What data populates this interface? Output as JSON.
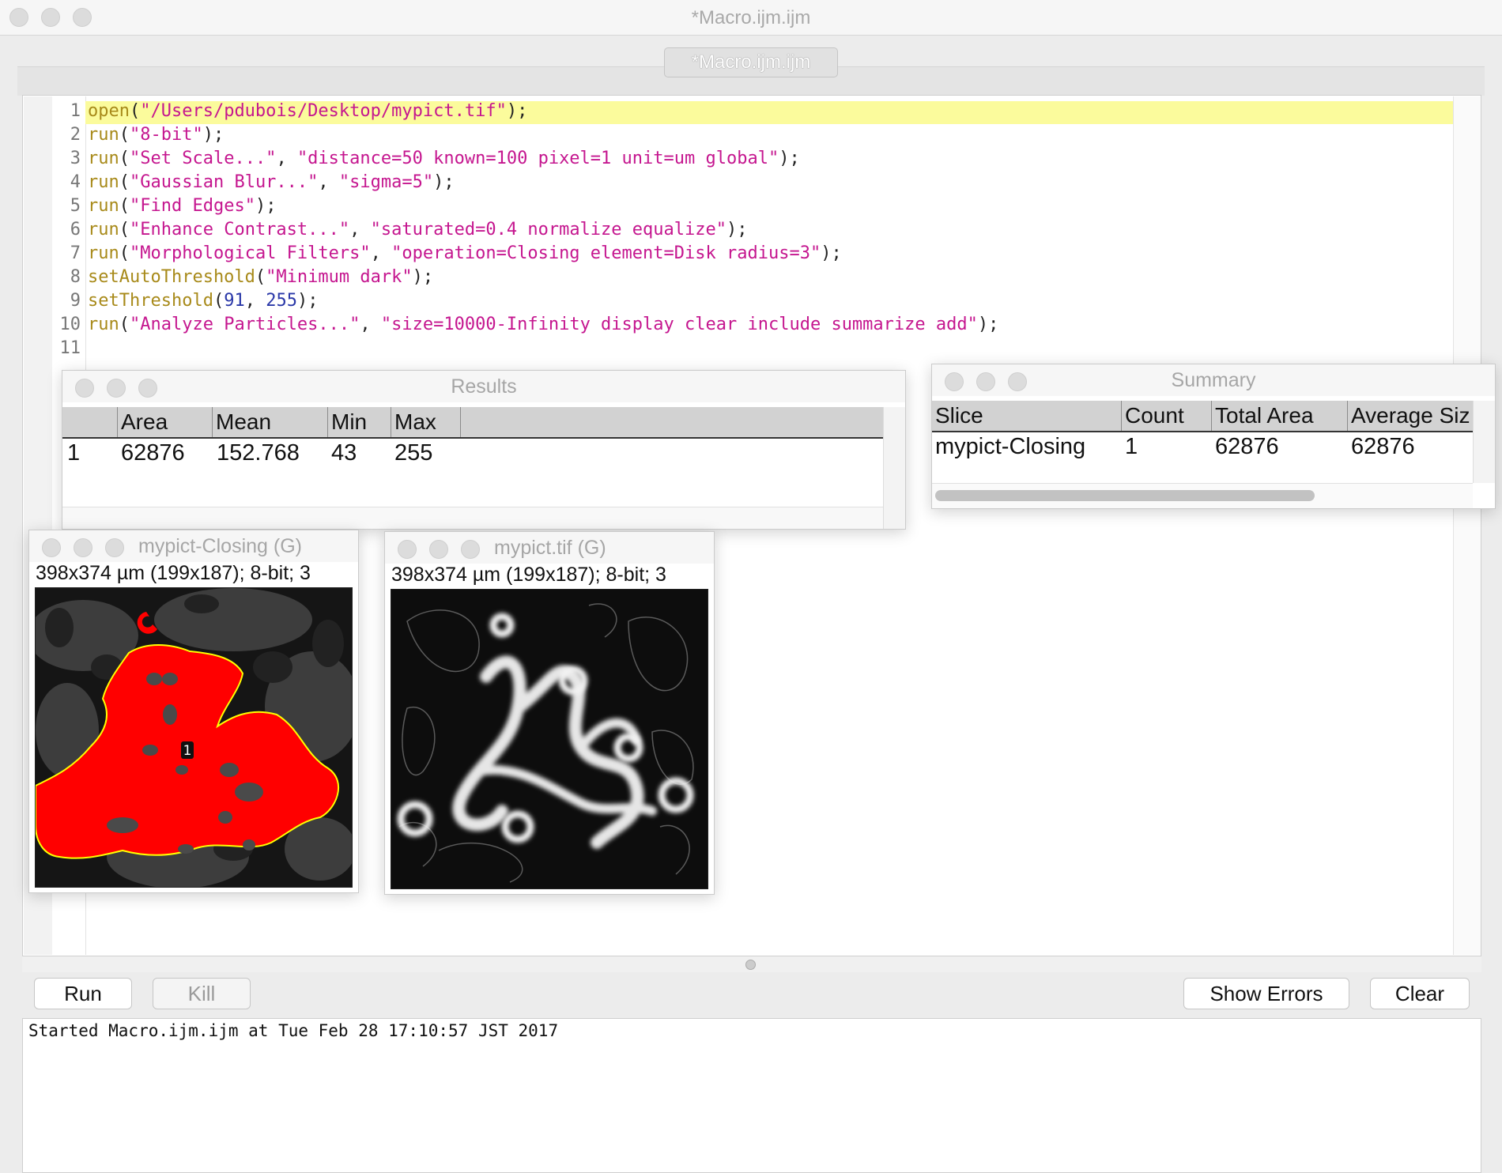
{
  "window": {
    "title": "*Macro.ijm.ijm",
    "tab_label": "*Macro.ijm.ijm"
  },
  "editor": {
    "line_numbers": [
      "1",
      "2",
      "3",
      "4",
      "5",
      "6",
      "7",
      "8",
      "9",
      "10",
      "11"
    ],
    "lines": [
      [
        {
          "c": "fn",
          "t": "open"
        },
        {
          "c": "pn",
          "t": "("
        },
        {
          "c": "str",
          "t": "\"/Users/pdubois/Desktop/mypict.tif\""
        },
        {
          "c": "pn",
          "t": ");"
        }
      ],
      [
        {
          "c": "fn",
          "t": "run"
        },
        {
          "c": "pn",
          "t": "("
        },
        {
          "c": "str",
          "t": "\"8-bit\""
        },
        {
          "c": "pn",
          "t": ");"
        }
      ],
      [
        {
          "c": "fn",
          "t": "run"
        },
        {
          "c": "pn",
          "t": "("
        },
        {
          "c": "str",
          "t": "\"Set Scale...\""
        },
        {
          "c": "pn",
          "t": ", "
        },
        {
          "c": "str",
          "t": "\"distance=50 known=100 pixel=1 unit=um global\""
        },
        {
          "c": "pn",
          "t": ");"
        }
      ],
      [
        {
          "c": "fn",
          "t": "run"
        },
        {
          "c": "pn",
          "t": "("
        },
        {
          "c": "str",
          "t": "\"Gaussian Blur...\""
        },
        {
          "c": "pn",
          "t": ", "
        },
        {
          "c": "str",
          "t": "\"sigma=5\""
        },
        {
          "c": "pn",
          "t": ");"
        }
      ],
      [
        {
          "c": "fn",
          "t": "run"
        },
        {
          "c": "pn",
          "t": "("
        },
        {
          "c": "str",
          "t": "\"Find Edges\""
        },
        {
          "c": "pn",
          "t": ");"
        }
      ],
      [
        {
          "c": "fn",
          "t": "run"
        },
        {
          "c": "pn",
          "t": "("
        },
        {
          "c": "str",
          "t": "\"Enhance Contrast...\""
        },
        {
          "c": "pn",
          "t": ", "
        },
        {
          "c": "str",
          "t": "\"saturated=0.4 normalize equalize\""
        },
        {
          "c": "pn",
          "t": ");"
        }
      ],
      [
        {
          "c": "fn",
          "t": "run"
        },
        {
          "c": "pn",
          "t": "("
        },
        {
          "c": "str",
          "t": "\"Morphological Filters\""
        },
        {
          "c": "pn",
          "t": ", "
        },
        {
          "c": "str",
          "t": "\"operation=Closing element=Disk radius=3\""
        },
        {
          "c": "pn",
          "t": ");"
        }
      ],
      [
        {
          "c": "fn",
          "t": "setAutoThreshold"
        },
        {
          "c": "pn",
          "t": "("
        },
        {
          "c": "str",
          "t": "\"Minimum dark\""
        },
        {
          "c": "pn",
          "t": ");"
        }
      ],
      [
        {
          "c": "fn",
          "t": "setThreshold"
        },
        {
          "c": "pn",
          "t": "("
        },
        {
          "c": "num",
          "t": "91"
        },
        {
          "c": "pn",
          "t": ", "
        },
        {
          "c": "num",
          "t": "255"
        },
        {
          "c": "pn",
          "t": ");"
        }
      ],
      [
        {
          "c": "fn",
          "t": "run"
        },
        {
          "c": "pn",
          "t": "("
        },
        {
          "c": "str",
          "t": "\"Analyze Particles...\""
        },
        {
          "c": "pn",
          "t": ", "
        },
        {
          "c": "str",
          "t": "\"size=10000-Infinity display clear include summarize add\""
        },
        {
          "c": "pn",
          "t": ");"
        }
      ],
      []
    ]
  },
  "results": {
    "title": "Results",
    "headers": [
      "",
      "Area",
      "Mean",
      "Min",
      "Max"
    ],
    "rows": [
      [
        "1",
        "62876",
        "152.768",
        "43",
        "255"
      ]
    ]
  },
  "summary": {
    "title": "Summary",
    "headers": [
      "Slice",
      "Count",
      "Total Area",
      "Average Siz"
    ],
    "rows": [
      [
        "mypict-Closing",
        "1",
        "62876",
        "62876"
      ]
    ]
  },
  "image_closing": {
    "title": "mypict-Closing (G)",
    "info": "398x374 µm (199x187); 8-bit; 3",
    "roi_label": "1"
  },
  "image_orig": {
    "title": "mypict.tif (G)",
    "info": "398x374 µm (199x187); 8-bit; 3"
  },
  "buttons": {
    "run": "Run",
    "kill": "Kill",
    "show_errors": "Show Errors",
    "clear": "Clear"
  },
  "log": {
    "text": "Started Macro.ijm.ijm at Tue Feb 28 17:10:57 JST 2017"
  },
  "colors": {
    "highlight": "#fbfb9c",
    "function": "#a88a1a",
    "string": "#c5168f",
    "number": "#2a38a8",
    "roi_fill": "#ff0000",
    "roi_outline": "#ffff00"
  }
}
